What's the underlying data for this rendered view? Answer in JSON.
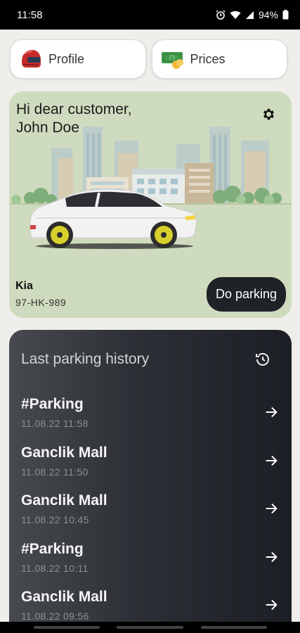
{
  "status_bar": {
    "time": "11:58",
    "battery": "94%"
  },
  "top_buttons": {
    "profile_label": "Profile",
    "prices_label": "Prices"
  },
  "hero": {
    "greeting_line1": "Hi dear customer,",
    "greeting_line2": "John Doe",
    "car_model": "Kia",
    "car_plate": "97-HK-989",
    "action_label": "Do parking"
  },
  "history": {
    "title": "Last parking history",
    "items": [
      {
        "name": "#Parking",
        "date": "11.08.22 11:58"
      },
      {
        "name": "Ganclik Mall",
        "date": "11.08.22 11:50"
      },
      {
        "name": "Ganclik Mall",
        "date": "11.08.22 10:45"
      },
      {
        "name": "#Parking",
        "date": "11.08.22 10:11"
      },
      {
        "name": "Ganclik Mall",
        "date": "11.08.22 09:56"
      }
    ]
  },
  "icons": {
    "profile": "helmet-icon",
    "prices": "money-icon",
    "settings": "gear-icon",
    "history": "history-icon",
    "row": "arrow-right-icon"
  },
  "colors": {
    "hero_bg": "#cfdbbe",
    "history_bg": "#2c2f35",
    "button_dark": "#1f2227"
  }
}
